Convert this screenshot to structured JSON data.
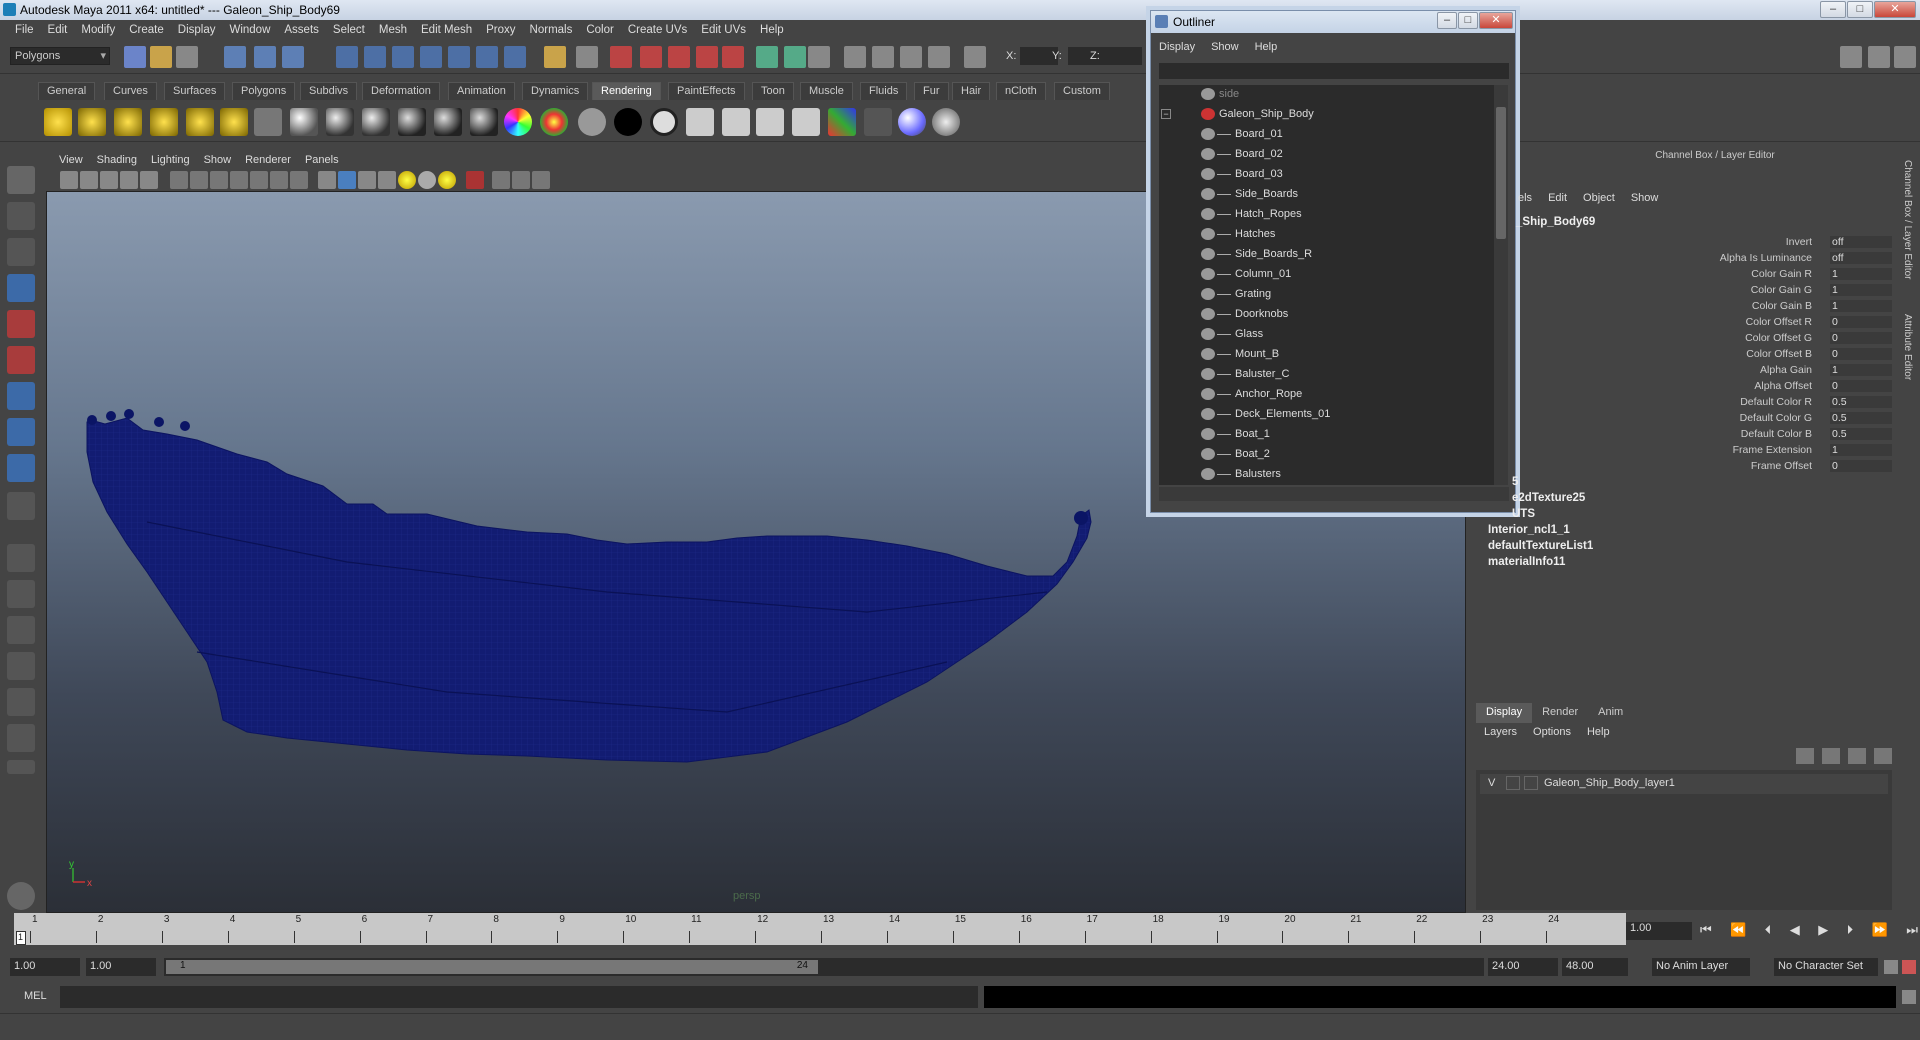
{
  "window": {
    "title": "Autodesk Maya 2011 x64: untitled*   ---   Galeon_Ship_Body69",
    "min": "–",
    "max": "□",
    "close": "✕"
  },
  "menubar": [
    "File",
    "Edit",
    "Modify",
    "Create",
    "Display",
    "Window",
    "Assets",
    "Select",
    "Mesh",
    "Edit Mesh",
    "Proxy",
    "Normals",
    "Color",
    "Create UVs",
    "Edit UVs",
    "Help"
  ],
  "status": {
    "mode": "Polygons",
    "x_label": "X:",
    "y_label": "Y:",
    "z_label": "Z:"
  },
  "shelf_tabs": [
    "General",
    "Curves",
    "Surfaces",
    "Polygons",
    "Subdivs",
    "Deformation",
    "Animation",
    "Dynamics",
    "Rendering",
    "PaintEffects",
    "Toon",
    "Muscle",
    "Fluids",
    "Fur",
    "Hair",
    "nCloth",
    "Custom"
  ],
  "shelf_active": "Rendering",
  "viewport": {
    "menu": [
      "View",
      "Shading",
      "Lighting",
      "Show",
      "Renderer",
      "Panels"
    ],
    "camera_label": "persp",
    "axis_y": "y",
    "axis_x": "x"
  },
  "outliner": {
    "title": "Outliner",
    "menu": [
      "Display",
      "Show",
      "Help"
    ],
    "items": [
      {
        "label": "side",
        "level": 0,
        "dim": true
      },
      {
        "label": "Galeon_Ship_Body",
        "level": 0,
        "expanded": true
      },
      {
        "label": "Board_01",
        "level": 1
      },
      {
        "label": "Board_02",
        "level": 1
      },
      {
        "label": "Board_03",
        "level": 1
      },
      {
        "label": "Side_Boards",
        "level": 1
      },
      {
        "label": "Hatch_Ropes",
        "level": 1
      },
      {
        "label": "Hatches",
        "level": 1
      },
      {
        "label": "Side_Boards_R",
        "level": 1
      },
      {
        "label": "Column_01",
        "level": 1
      },
      {
        "label": "Grating",
        "level": 1
      },
      {
        "label": "Doorknobs",
        "level": 1
      },
      {
        "label": "Glass",
        "level": 1
      },
      {
        "label": "Mount_B",
        "level": 1
      },
      {
        "label": "Baluster_C",
        "level": 1
      },
      {
        "label": "Anchor_Rope",
        "level": 1
      },
      {
        "label": "Deck_Elements_01",
        "level": 1
      },
      {
        "label": "Boat_1",
        "level": 1
      },
      {
        "label": "Boat_2",
        "level": 1
      },
      {
        "label": "Balusters",
        "level": 1
      }
    ]
  },
  "channel_box": {
    "title": "Channel Box / Layer Editor",
    "menu": [
      "els",
      "Edit",
      "Object",
      "Show"
    ],
    "node": "_Ship_Body69",
    "attributes": [
      {
        "k": "Invert",
        "v": "off"
      },
      {
        "k": "Alpha Is Luminance",
        "v": "off"
      },
      {
        "k": "Color Gain R",
        "v": "1"
      },
      {
        "k": "Color Gain G",
        "v": "1"
      },
      {
        "k": "Color Gain B",
        "v": "1"
      },
      {
        "k": "Color Offset R",
        "v": "0"
      },
      {
        "k": "Color Offset G",
        "v": "0"
      },
      {
        "k": "Color Offset B",
        "v": "0"
      },
      {
        "k": "Alpha Gain",
        "v": "1"
      },
      {
        "k": "Alpha Offset",
        "v": "0"
      },
      {
        "k": "Default Color R",
        "v": "0.5"
      },
      {
        "k": "Default Color G",
        "v": "0.5"
      },
      {
        "k": "Default Color B",
        "v": "0.5"
      },
      {
        "k": "Frame Extension",
        "v": "1"
      },
      {
        "k": "Frame Offset",
        "v": "0"
      }
    ],
    "nodes": [
      "5",
      "e2dTexture25",
      "UTS",
      "Interior_ncl1_1",
      "defaultTextureList1",
      "materialInfo11"
    ]
  },
  "side_tabs": [
    "Channel Box / Layer Editor",
    "Attribute Editor"
  ],
  "layer_editor": {
    "tabs": [
      "Display",
      "Render",
      "Anim"
    ],
    "active_tab": "Display",
    "menu": [
      "Layers",
      "Options",
      "Help"
    ],
    "layer": {
      "visible": "V",
      "name": "Galeon_Ship_Body_layer1"
    }
  },
  "timeline": {
    "ticks": [
      "1",
      "2",
      "3",
      "4",
      "5",
      "6",
      "7",
      "8",
      "9",
      "10",
      "11",
      "12",
      "13",
      "14",
      "15",
      "16",
      "17",
      "18",
      "19",
      "20",
      "21",
      "22",
      "23",
      "24"
    ],
    "current_frame": "1.00",
    "current_marker": "1"
  },
  "range": {
    "start": "1.00",
    "anim_start": "1.00",
    "range_start": "1",
    "range_end": "24",
    "end": "24.00",
    "anim_end": "48.00",
    "anim_layer": "No Anim Layer",
    "char_set": "No Character Set"
  },
  "cmdline": {
    "label": "MEL"
  },
  "colors": {
    "mesh": "#101a6e",
    "bg": "#444444",
    "field": "#2b2b2b"
  }
}
